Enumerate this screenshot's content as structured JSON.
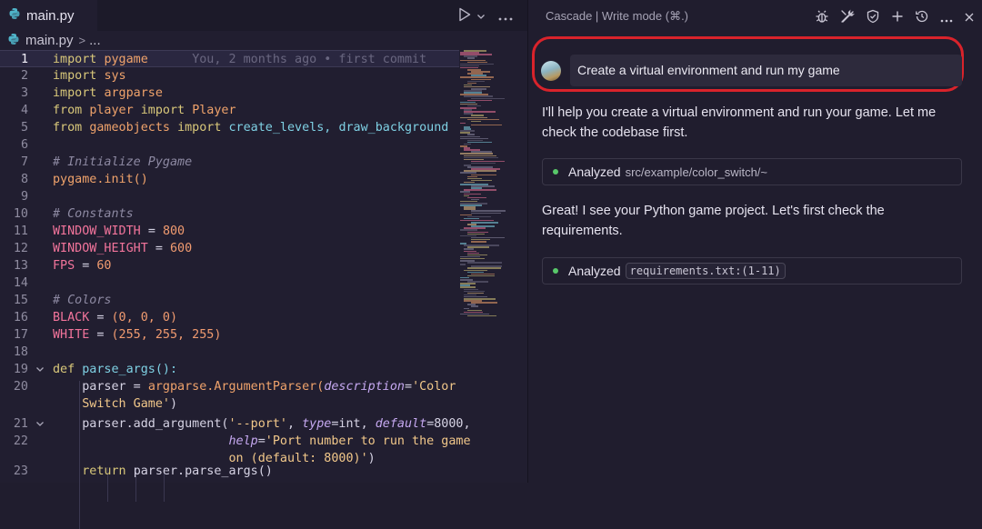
{
  "editor": {
    "tab": {
      "filename": "main.py"
    },
    "breadcrumb": {
      "file": "main.py",
      "separator": ">",
      "ellipsis": "..."
    },
    "blame": "You, 2 months ago • first commit",
    "line_numbers": [
      "1",
      "2",
      "3",
      "4",
      "5",
      "6",
      "7",
      "8",
      "9",
      "10",
      "11",
      "12",
      "13",
      "14",
      "15",
      "16",
      "17",
      "18",
      "19",
      "20",
      "",
      "21",
      "22",
      "",
      "23"
    ],
    "tokens": {
      "import": "import",
      "from": "from",
      "def": "def",
      "return": "return",
      "pygame": "pygame",
      "sys": "sys",
      "argparse": "argparse",
      "player": "player",
      "Player": "Player",
      "gameobjects": "gameobjects",
      "create_levels": "create_levels,",
      "draw_background": "draw_background",
      "c_init": "# Initialize Pygame",
      "pygame_init": "pygame.init()",
      "c_consts": "# Constants",
      "ww": "WINDOW_WIDTH",
      "eq": "=",
      "v800": "800",
      "wh": "WINDOW_HEIGHT",
      "v600": "600",
      "fps": "FPS",
      "v60": "60",
      "c_colors": "# Colors",
      "black": "BLACK",
      "black_val": "(0, 0, 0)",
      "white": "WHITE",
      "white_val": "(255, 255, 255)",
      "parse_args_def": "parse_args():",
      "parser_assign": "parser =",
      "argparse_dot": "argparse.",
      "ArgumentParser": "ArgumentParser(",
      "description": "description",
      "desc_eq": "=",
      "desc_str1": "'Color",
      "desc_str2": "Switch Game'",
      "close_paren": ")",
      "add_arg": "parser.add_argument(",
      "port_str": "'--port'",
      "comma": ",",
      "type_kw": "type",
      "type_val": "=int,",
      "default_kw": "default",
      "default_val": "=8000,",
      "help_kw": "help",
      "help_eq": "=",
      "help_str1": "'Port number to run the game",
      "help_str2": "on (default: 8000)'",
      "help_close": ")",
      "return_expr": "parser.parse_args()"
    }
  },
  "panel": {
    "title": "Cascade | Write mode (⌘.)",
    "user_message": "Create a virtual environment and run my game",
    "reply1": "I'll help you create a virtual environment and run your game. Let me check the codebase first.",
    "analyzed1": {
      "label": "Analyzed",
      "path": "src/example/color_switch/~"
    },
    "reply2": "Great! I see your Python game project. Let's first check the requirements.",
    "analyzed2": {
      "label": "Analyzed",
      "chip": "requirements.txt:(1-11)"
    }
  },
  "icons": [
    "python-file-icon",
    "run-icon",
    "chevron-down-icon",
    "more-icon",
    "bug-icon",
    "tools-icon",
    "shield-icon",
    "plus-icon",
    "history-icon",
    "close-icon"
  ],
  "colors": {
    "highlight_border": "#d9232b",
    "status_dot": "#58c86a",
    "editor_bg": "#211e30"
  }
}
